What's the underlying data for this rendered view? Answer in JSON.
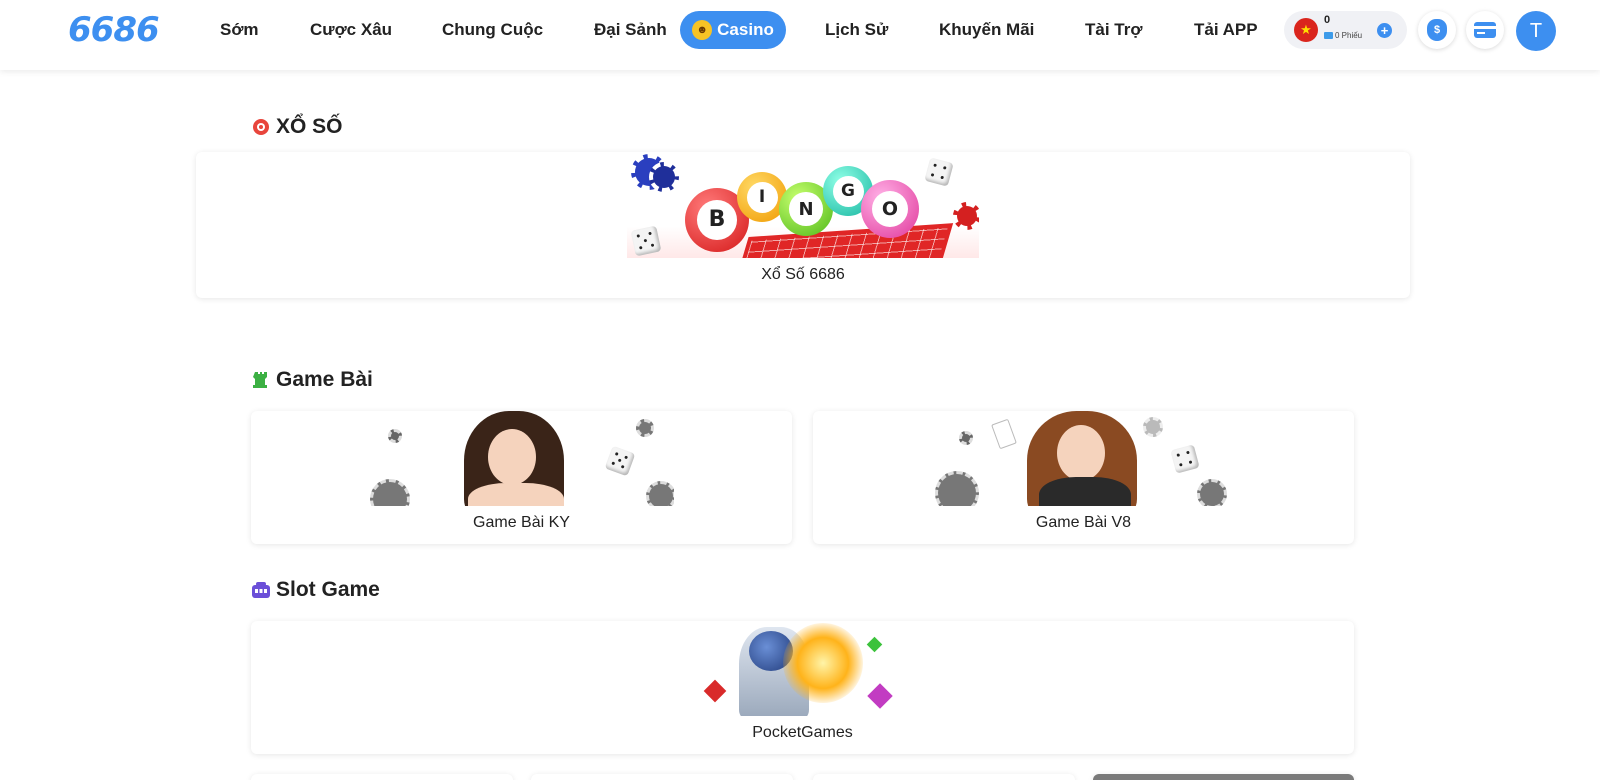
{
  "header": {
    "logo": "6686",
    "nav": [
      {
        "label": "Sớm"
      },
      {
        "label": "Cược Xâu"
      },
      {
        "label": "Chung Cuộc"
      },
      {
        "label": "Đại Sảnh"
      },
      {
        "label": "Casino",
        "active": true
      },
      {
        "label": "Lịch Sử"
      },
      {
        "label": "Khuyến Mãi"
      },
      {
        "label": "Tài Trợ"
      },
      {
        "label": "Tải APP"
      }
    ],
    "wallet": {
      "balance": "0",
      "tickets": "0 Phiếu",
      "flag_icon": "vietnam-flag-icon",
      "add_icon": "plus-icon"
    },
    "buttons": [
      {
        "icon": "money-bag-icon"
      },
      {
        "icon": "credit-card-icon"
      }
    ],
    "avatar_letter": "T"
  },
  "sections": {
    "lottery": {
      "title": "XỔ SỐ",
      "icon": "lottery-ball-icon",
      "items": [
        {
          "caption": "Xổ Số 6686",
          "balls": [
            "B",
            "I",
            "N",
            "G",
            "O"
          ]
        }
      ]
    },
    "cards": {
      "title": "Game Bài",
      "icon": "chess-rook-icon",
      "items": [
        {
          "caption": "Game Bài KY"
        },
        {
          "caption": "Game Bài V8"
        }
      ]
    },
    "slots": {
      "title": "Slot Game",
      "icon": "slot-machine-icon",
      "items": [
        {
          "caption": "PocketGames"
        }
      ]
    }
  },
  "colors": {
    "accent": "#3d8ff0",
    "text": "#222222",
    "lottery_icon": "#e8453c",
    "cards_icon": "#3cb043",
    "slots_icon": "#6b4fd8"
  }
}
